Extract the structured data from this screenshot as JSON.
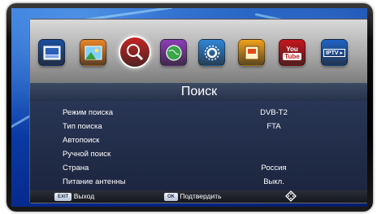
{
  "menu_icons": [
    {
      "name": "program-icon",
      "text": "PROGRAM",
      "color": "#1b4f9e",
      "selected": false
    },
    {
      "name": "picture-icon",
      "text": "",
      "color": "#e8862a",
      "selected": false
    },
    {
      "name": "search-icon",
      "text": "",
      "color": "#c32424",
      "selected": true
    },
    {
      "name": "globe-icon",
      "text": "",
      "color": "#8a3fb5",
      "selected": false
    },
    {
      "name": "settings-icon",
      "text": "",
      "color": "#2f86d8",
      "selected": false
    },
    {
      "name": "media-icon",
      "text": "",
      "color": "#f0a21c",
      "selected": false
    },
    {
      "name": "youtube-icon",
      "text": "You Tube",
      "color": "#c4161c",
      "selected": false
    },
    {
      "name": "iptv-icon",
      "text": "IPTV",
      "color": "#1f63c4",
      "selected": false
    }
  ],
  "page_title": "Поиск",
  "settings": [
    {
      "label": "Режим поиска",
      "value": "DVB-T2"
    },
    {
      "label": "Тип поиска",
      "value": "FTA"
    },
    {
      "label": "Автопоиск",
      "value": ""
    },
    {
      "label": "Ручной поиск",
      "value": ""
    },
    {
      "label": "Страна",
      "value": "Россия"
    },
    {
      "label": "Питание антенны",
      "value": "Выкл."
    }
  ],
  "footer": {
    "exit_key": "EXIT",
    "exit_label": "Выход",
    "ok_key": "OK",
    "ok_label": "Подтвердить"
  }
}
